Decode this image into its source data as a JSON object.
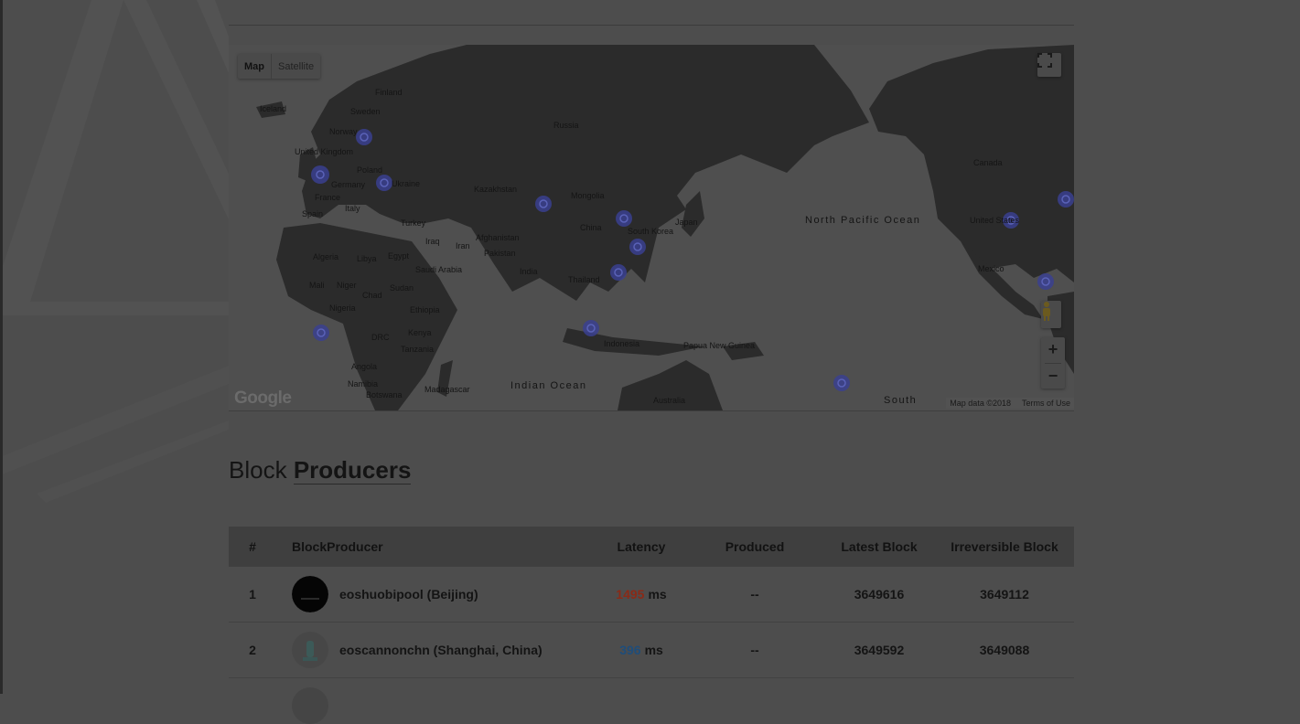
{
  "map": {
    "type_controls": {
      "map": "Map",
      "satellite": "Satellite"
    },
    "fullscreen_icon": "fullscreen-icon",
    "zoom": {
      "in": "+",
      "out": "−"
    },
    "pegman_icon": "pegman-icon",
    "google_logo": "Google",
    "attribution": {
      "data": "Map data ©2018",
      "terms": "Terms of Use"
    },
    "labels": [
      "Finland",
      "Sweden",
      "Norway",
      "Iceland",
      "United Kingdom",
      "Poland",
      "Germany",
      "Ukraine",
      "France",
      "Italy",
      "Spain",
      "Russia",
      "Kazakhstan",
      "Mongolia",
      "China",
      "Japan",
      "South Korea",
      "Turkey",
      "Iraq",
      "Iran",
      "Afghanistan",
      "Pakistan",
      "India",
      "Saudi Arabia",
      "Egypt",
      "Libya",
      "Algeria",
      "Mali",
      "Niger",
      "Chad",
      "Sudan",
      "Ethiopia",
      "Nigeria",
      "Kenya",
      "DRC",
      "Tanzania",
      "Angola",
      "Namibia",
      "Botswana",
      "Madagascar",
      "Thailand",
      "Indonesia",
      "Papua New Guinea",
      "Australia",
      "North Pacific Ocean",
      "Indian Ocean",
      "South",
      "Canada",
      "United States",
      "Mexico"
    ],
    "colors": {
      "land": "#2b2b2b",
      "water": "#4f4f4f",
      "marker": "#3a3f8f"
    }
  },
  "section": {
    "title_light": "Block",
    "title_strong": "Producers"
  },
  "table": {
    "headers": {
      "num": "#",
      "producer": "BlockProducer",
      "latency": "Latency",
      "produced": "Produced",
      "latest": "Latest Block",
      "irreversible": "Irreversible Block"
    },
    "rows": [
      {
        "num": "1",
        "name": "eoshuobipool (Beijing)",
        "latency": "1495",
        "latency_unit": "ms",
        "latency_color": "#8a2a17",
        "produced": "--",
        "latest": "3649616",
        "irreversible": "3649112"
      },
      {
        "num": "2",
        "name": "eoscannonchn (Shanghai, China)",
        "latency": "396",
        "latency_unit": "ms",
        "latency_color": "#1f4d7a",
        "produced": "--",
        "latest": "3649592",
        "irreversible": "3649088"
      }
    ]
  }
}
